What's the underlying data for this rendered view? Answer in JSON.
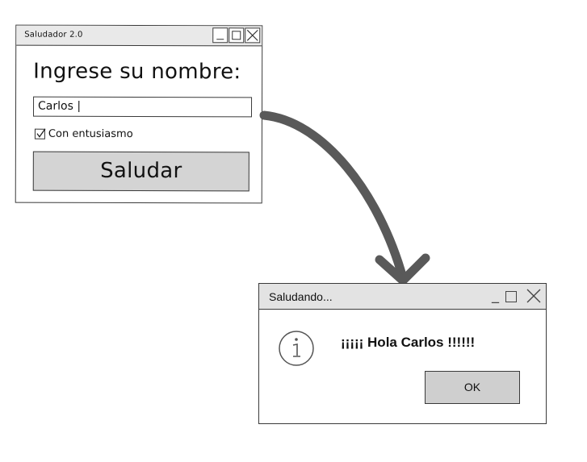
{
  "window1": {
    "title": "Saludador 2.0",
    "heading": "Ingrese su nombre:",
    "name_input_value": "Carlos |",
    "checkbox_label": "Con entusiasmo",
    "checkbox_checked": true,
    "button_label": "Saludar"
  },
  "window2": {
    "title": "Saludando...",
    "message": "¡¡¡¡¡ Hola Carlos !!!!!!",
    "ok_label": "OK",
    "icon": "info-icon"
  },
  "arrow": {
    "color": "#595959",
    "icon": "curved-arrow"
  }
}
